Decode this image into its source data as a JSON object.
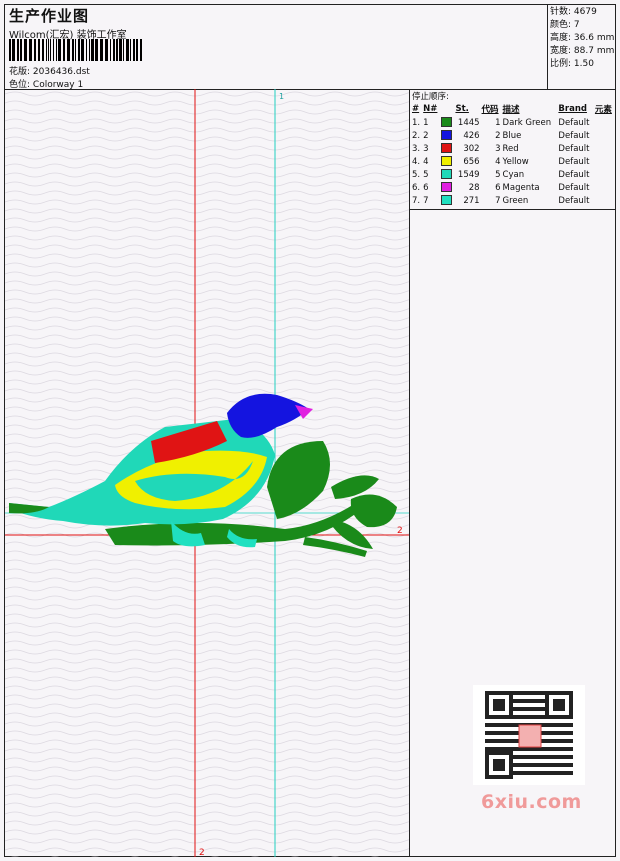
{
  "header": {
    "title": "生产作业图",
    "company": "Wilcom(汇宏) 装饰工作室",
    "design_label": "花版:",
    "design_value": "2036436.dst",
    "colorway_label": "色位:",
    "colorway_value": "Colorway 1"
  },
  "stats": [
    {
      "label": "针数:",
      "value": "4679"
    },
    {
      "label": "颜色:",
      "value": "7"
    },
    {
      "label": "高度:",
      "value": "36.6 mm"
    },
    {
      "label": "宽度:",
      "value": "88.7 mm"
    },
    {
      "label": "比例:",
      "value": "1.50"
    }
  ],
  "stop_sequence": {
    "heading": "停止顺序:",
    "columns": [
      "#",
      "N#",
      "St.",
      "代码",
      "描述",
      "Brand",
      "元素"
    ],
    "rows": [
      {
        "idx": "1.",
        "n": "1",
        "color": "#1a8a1a",
        "st": "1445",
        "code": "1",
        "desc": "Dark Green",
        "brand": "Default"
      },
      {
        "idx": "2.",
        "n": "2",
        "color": "#1414e0",
        "st": "426",
        "code": "2",
        "desc": "Blue",
        "brand": "Default"
      },
      {
        "idx": "3.",
        "n": "3",
        "color": "#e01414",
        "st": "302",
        "code": "3",
        "desc": "Red",
        "brand": "Default"
      },
      {
        "idx": "4.",
        "n": "4",
        "color": "#f0f000",
        "st": "656",
        "code": "4",
        "desc": "Yellow",
        "brand": "Default"
      },
      {
        "idx": "5.",
        "n": "5",
        "color": "#20d8b8",
        "st": "1549",
        "code": "5",
        "desc": "Cyan",
        "brand": "Default"
      },
      {
        "idx": "6.",
        "n": "6",
        "color": "#e020e0",
        "st": "28",
        "code": "6",
        "desc": "Magenta",
        "brand": "Default"
      },
      {
        "idx": "7.",
        "n": "7",
        "color": "#20e0c0",
        "st": "271",
        "code": "7",
        "desc": "Green",
        "brand": "Default"
      }
    ]
  },
  "guides": {
    "v_cyan_label": "1",
    "v_red_label": "2",
    "h_red_label": "2"
  },
  "watermark": {
    "brand": "6xiu.com"
  },
  "colors": {
    "red_guide": "#e01010",
    "cyan_guide": "#20d0c0"
  }
}
